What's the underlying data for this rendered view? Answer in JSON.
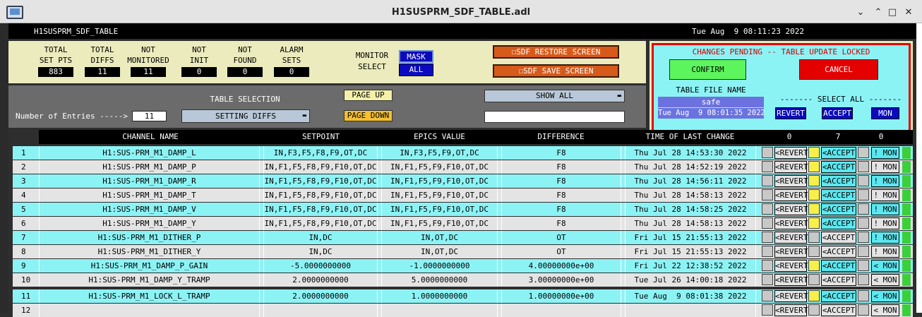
{
  "window": {
    "title": "H1SUSPRM_SDF_TABLE.adl",
    "controls": [
      "⌄",
      "⌃",
      "□",
      "✕"
    ]
  },
  "header": {
    "name": "H1SUSPRM_SDF_TABLE",
    "datetime": "Tue Aug  9 08:11:23 2022"
  },
  "stats": [
    {
      "label_1": "TOTAL",
      "label_2": "SET PTS",
      "value": "883"
    },
    {
      "label_1": "TOTAL",
      "label_2": "DIFFS",
      "value": "11"
    },
    {
      "label_1": "NOT",
      "label_2": "MONITORED",
      "value": "11"
    },
    {
      "label_1": "NOT",
      "label_2": "INIT",
      "value": "0"
    },
    {
      "label_1": "NOT",
      "label_2": "FOUND",
      "value": "0"
    },
    {
      "label_1": "ALARM",
      "label_2": "SETS",
      "value": "0"
    }
  ],
  "monitor_select": {
    "label_1": "MONITOR",
    "label_2": "SELECT",
    "mask_label": "MASK",
    "all_label": "ALL"
  },
  "actions": {
    "restore_label": "☐SDF RESTORE SCREEN",
    "save_label": "☐SDF SAVE SCREEN"
  },
  "lock_panel": {
    "status": "CHANGES PENDING -- TABLE UPDATE LOCKED",
    "confirm_label": "CONFIRM",
    "cancel_label": "CANCEL",
    "table_file_label": "TABLE FILE NAME",
    "table_file_value": "safe",
    "table_file_date": "Tue Aug  9 08:01:35 2022",
    "select_all_label": "------- SELECT ALL -------",
    "revert_label": "REVERT",
    "accept_label": "ACCEPT",
    "mon_label": "MON"
  },
  "selection": {
    "entries_label": "Number of Entries ----->",
    "entries_value": "11",
    "table_selection_label": "TABLE SELECTION",
    "table_selection_value": "SETTING DIFFS",
    "page_up_label": "PAGE UP",
    "page_down_label": "PAGE DOWN",
    "show_all_label": "SHOW ALL",
    "filter_value": ""
  },
  "table": {
    "columns": [
      "CHANNEL NAME",
      "SETPOINT",
      "EPICS VALUE",
      "DIFFERENCE",
      "TIME OF LAST CHANGE"
    ],
    "counts": [
      "0",
      "7",
      "0"
    ],
    "revert_label": "<REVERT",
    "accept_label": "<ACCEPT",
    "mon_label_on": "! MON",
    "mon_label_off": "< MON",
    "rows": [
      {
        "num": "1",
        "channel": "H1:SUS-PRM_M1_DAMP_L",
        "setpoint": "IN,F3,F5,F8,F9,OT,DC",
        "epics": "IN,F3,F5,F9,OT,DC",
        "diff": "F8",
        "time": "Thu Jul 28 14:53:30 2022",
        "accept": true,
        "mon": "! MON"
      },
      {
        "num": "2",
        "channel": "H1:SUS-PRM_M1_DAMP_P",
        "setpoint": "IN,F1,F5,F8,F9,F10,OT,DC",
        "epics": "IN,F1,F5,F9,F10,OT,DC",
        "diff": "F8",
        "time": "Thu Jul 28 14:52:19 2022",
        "accept": true,
        "mon": "! MON"
      },
      {
        "num": "3",
        "channel": "H1:SUS-PRM_M1_DAMP_R",
        "setpoint": "IN,F1,F5,F8,F9,F10,OT,DC",
        "epics": "IN,F1,F5,F9,F10,OT,DC",
        "diff": "F8",
        "time": "Thu Jul 28 14:56:11 2022",
        "accept": true,
        "mon": "! MON"
      },
      {
        "num": "4",
        "channel": "H1:SUS-PRM_M1_DAMP_T",
        "setpoint": "IN,F1,F5,F8,F9,F10,OT,DC",
        "epics": "IN,F1,F5,F9,F10,OT,DC",
        "diff": "F8",
        "time": "Thu Jul 28 14:58:13 2022",
        "accept": true,
        "mon": "! MON"
      },
      {
        "num": "5",
        "channel": "H1:SUS-PRM_M1_DAMP_V",
        "setpoint": "IN,F1,F5,F8,F9,F10,OT,DC",
        "epics": "IN,F1,F5,F9,F10,OT,DC",
        "diff": "F8",
        "time": "Thu Jul 28 14:58:25 2022",
        "accept": true,
        "mon": "! MON"
      },
      {
        "num": "6",
        "channel": "H1:SUS-PRM_M1_DAMP_Y",
        "setpoint": "IN,F1,F5,F8,F9,F10,OT,DC",
        "epics": "IN,F1,F5,F9,F10,OT,DC",
        "diff": "F8",
        "time": "Thu Jul 28 14:58:13 2022",
        "accept": true,
        "mon": "! MON"
      },
      {
        "num": "7",
        "channel": "H1:SUS-PRM_M1_DITHER_P",
        "setpoint": "IN,DC",
        "epics": "IN,OT,DC",
        "diff": "OT",
        "time": "Fri Jul 15 21:55:13 2022",
        "accept": false,
        "mon": "! MON"
      },
      {
        "num": "8",
        "channel": "H1:SUS-PRM_M1_DITHER_Y",
        "setpoint": "IN,DC",
        "epics": "IN,OT,DC",
        "diff": "OT",
        "time": "Fri Jul 15 21:55:13 2022",
        "accept": false,
        "mon": "! MON"
      },
      {
        "num": "9",
        "channel": "H1:SUS-PRM_M1_DAMP_P_GAIN",
        "setpoint": "-5.0000000000",
        "epics": "-1.0000000000",
        "diff": "4.00000000e+00",
        "time": "Fri Jul 22 12:38:52 2022",
        "accept": true,
        "mon": "< MON"
      },
      {
        "num": "10",
        "channel": "H1:SUS-PRM_M1_DAMP_Y_TRAMP",
        "setpoint": "2.0000000000",
        "epics": "5.0000000000",
        "diff": "3.00000000e+00",
        "time": "Tue Jul 26 14:00:18 2022",
        "accept": false,
        "mon": "< MON"
      },
      {
        "num": "11",
        "channel": "H1:SUS-PRM_M1_LOCK_L_TRAMP",
        "setpoint": "2.0000000000",
        "epics": "1.0000000000",
        "diff": "1.00000000e+00",
        "time": "Tue Aug  9 08:01:38 2022",
        "accept": true,
        "mon": "< MON"
      },
      {
        "num": "12",
        "channel": "",
        "setpoint": "",
        "epics": "",
        "diff": "",
        "time": "",
        "accept": false,
        "mon": "< MON"
      }
    ]
  },
  "colors": {
    "cyan_row": "#8cf3f5",
    "gray_row": "#e4e4e4",
    "panel_tan": "#ebebbd",
    "accent_blue": "#0a0abe",
    "alarm_red": "#e50000",
    "confirm_green": "#5df55d",
    "accept_yellow": "#f8f04a"
  }
}
